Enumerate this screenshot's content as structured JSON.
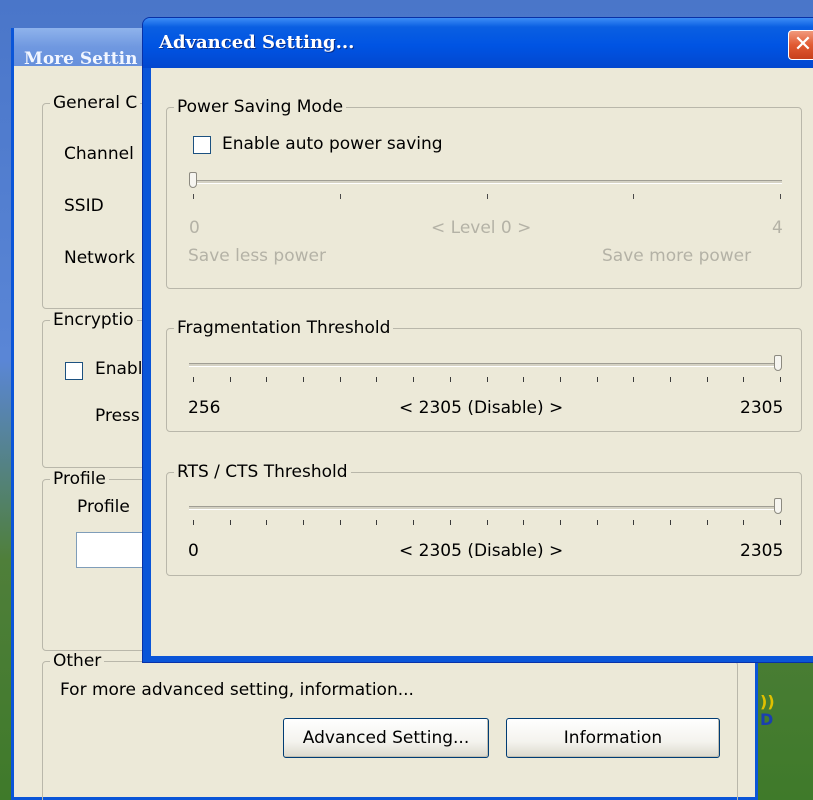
{
  "back_window": {
    "title": "More Settin",
    "general_group": {
      "legend": "General C",
      "channel_label": "Channel",
      "ssid_label": "SSID",
      "network_label": "Network"
    },
    "encryption_group": {
      "legend": "Encryptio",
      "enable_label": "Enabl",
      "press_label": "Press"
    },
    "profile_group": {
      "legend": "Profile",
      "profile_label": "Profile"
    },
    "other_group": {
      "legend": "Other",
      "description": "For more advanced setting, information...",
      "advanced_button": "Advanced Setting...",
      "information_button": "Information"
    }
  },
  "dialog": {
    "title": "Advanced Setting...",
    "close_glyph": "✕",
    "power_saving": {
      "legend": "Power Saving Mode",
      "checkbox_label": "Enable auto power saving",
      "checked": false,
      "slider_level": 0,
      "min_label": "0",
      "max_label": "4",
      "current_label": "< Level 0 >",
      "left_caption": "Save less power",
      "right_caption": "Save more power"
    },
    "fragmentation": {
      "legend": "Fragmentation Threshold",
      "slider_fraction": 1.0,
      "min_label": "256",
      "max_label": "2305",
      "current_label": "< 2305 (Disable) >"
    },
    "rts_cts": {
      "legend": "RTS / CTS Threshold",
      "slider_fraction": 1.0,
      "min_label": "0",
      "max_label": "2305",
      "current_label": "< 2305 (Disable) >"
    }
  },
  "colors": {
    "titlebar_blue": "#0054e3",
    "dialog_face": "#ece9d8",
    "close_red": "#e15a32",
    "disabled_text": "#b4b2a6"
  }
}
